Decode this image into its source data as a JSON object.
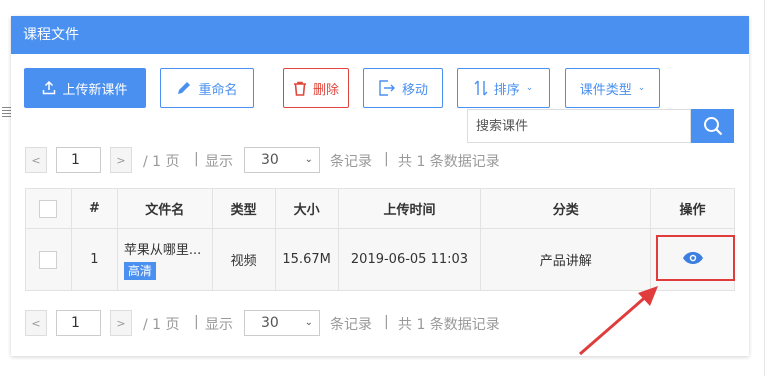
{
  "panel": {
    "title": "课程文件"
  },
  "toolbar": {
    "upload_label": "上传新课件",
    "rename_label": "重命名",
    "delete_label": "删除",
    "move_label": "移动",
    "sort_label": "排序",
    "type_label": "课件类型"
  },
  "search": {
    "placeholder": "搜索课件"
  },
  "pager": {
    "page_value": "1",
    "total_pages": "/ 1 页",
    "show_label": "显示",
    "page_size": "30",
    "records_label": "条记录",
    "total_label": "共 1 条数据记录"
  },
  "table": {
    "headers": [
      "#",
      "文件名",
      "类型",
      "大小",
      "上传时间",
      "分类",
      "操作"
    ],
    "rows": [
      {
        "index": "1",
        "name": "苹果从哪里...",
        "badge": "高清",
        "type": "视频",
        "size": "15.67M",
        "uploaded": "2019-06-05 11:03",
        "category": "产品讲解"
      }
    ]
  },
  "colors": {
    "accent": "#4a90f0",
    "danger": "#e0463c",
    "highlight": "#e03c3c"
  },
  "icons": [
    "upload-icon",
    "pencil-icon",
    "trash-icon",
    "move-icon",
    "sort-icon",
    "chevron-down-icon",
    "search-icon",
    "eye-icon"
  ]
}
